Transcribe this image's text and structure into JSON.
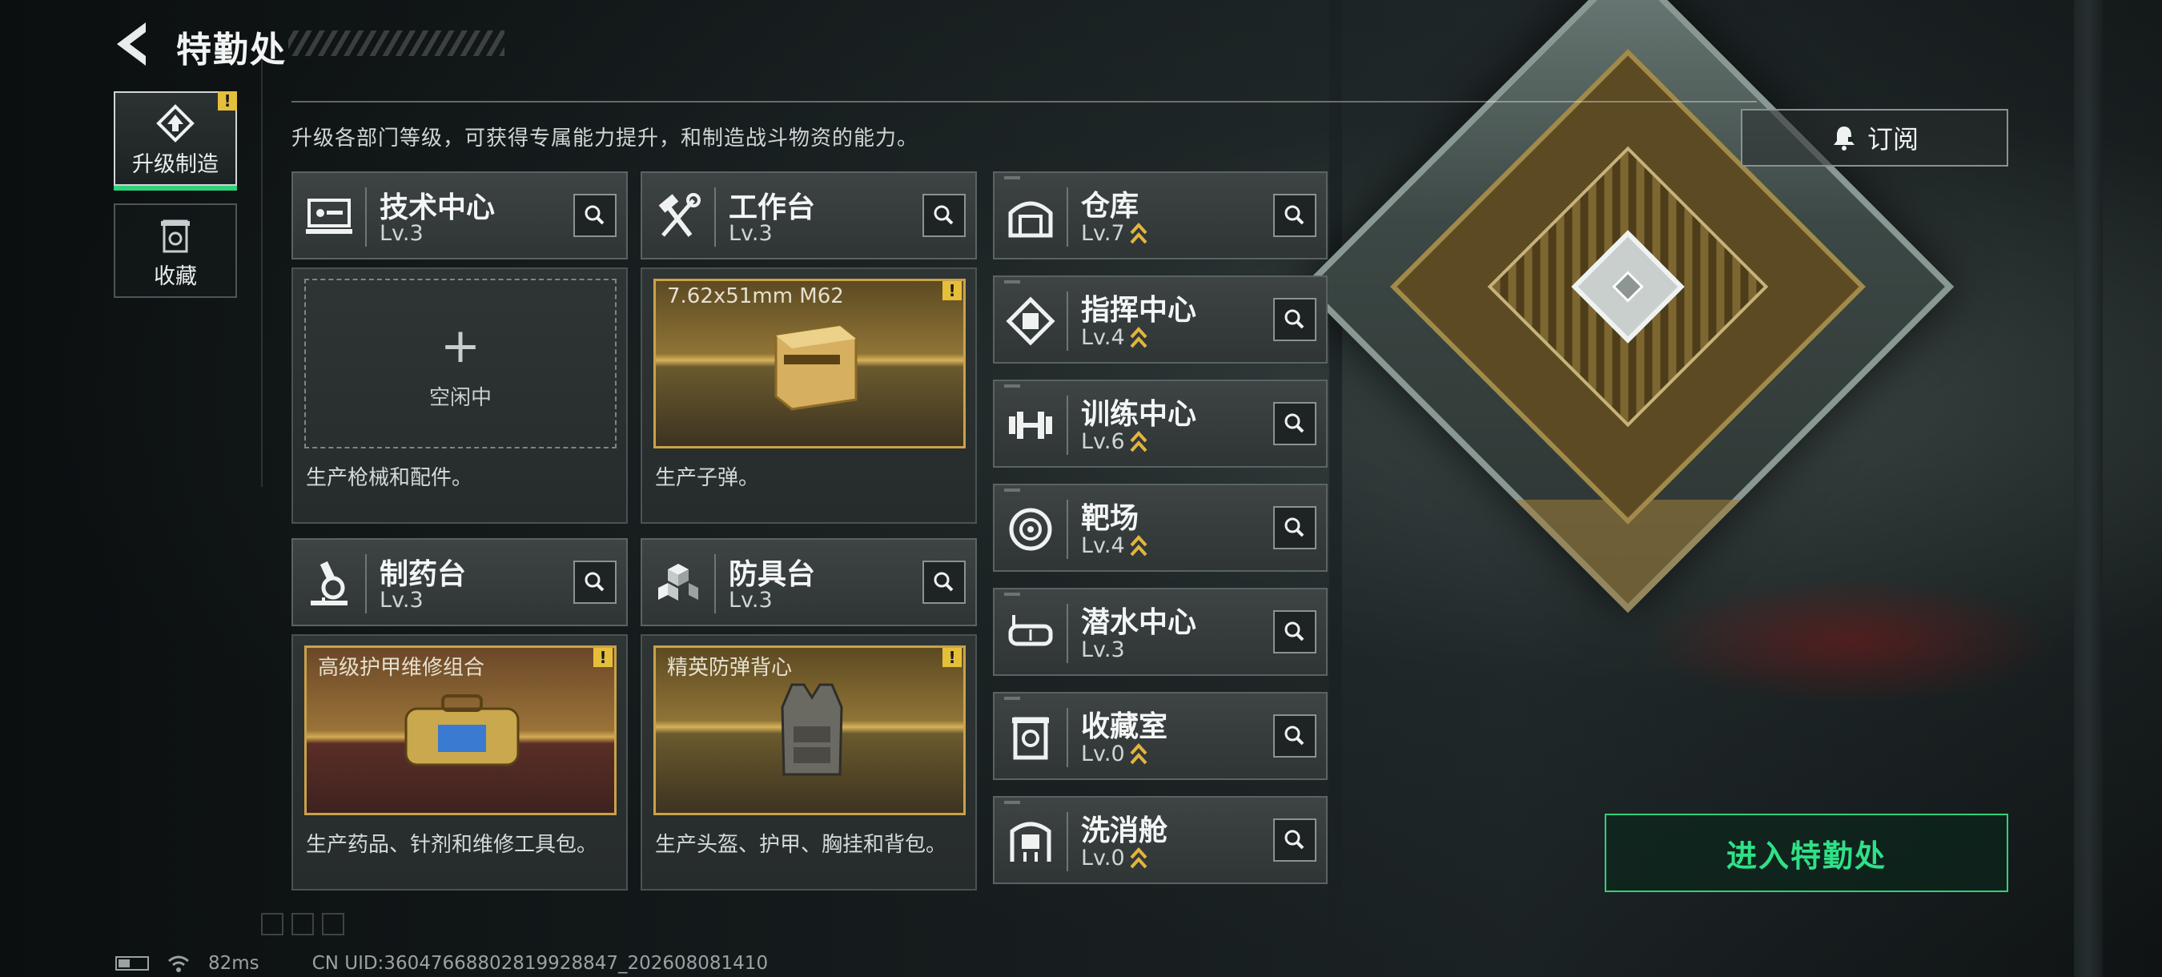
{
  "header": {
    "title": "特勤处"
  },
  "sidebar": {
    "tabs": [
      {
        "label": "升级制造",
        "active": true,
        "alert": "!"
      },
      {
        "label": "收藏",
        "active": false
      }
    ]
  },
  "description": "升级各部门等级，可获得专属能力提升，和制造战斗物资的能力。",
  "subscribe_label": "订阅",
  "stations": [
    {
      "name": "技术中心",
      "level": "Lv.3",
      "body": {
        "state": "idle",
        "plus": "+",
        "idle_label": "空闲中",
        "desc": "生产枪械和配件。"
      }
    },
    {
      "name": "工作台",
      "level": "Lv.3",
      "body": {
        "state": "producing",
        "item": "7.62x51mm M62",
        "alert": "!",
        "desc": "生产子弹。"
      }
    },
    {
      "name": "制药台",
      "level": "Lv.3",
      "body": {
        "state": "producing",
        "item": "高级护甲维修组合",
        "alert": "!",
        "desc": "生产药品、针剂和维修工具包。"
      }
    },
    {
      "name": "防具台",
      "level": "Lv.3",
      "body": {
        "state": "producing",
        "item": "精英防弹背心",
        "alert": "!",
        "desc": "生产头盔、护甲、胸挂和背包。"
      }
    }
  ],
  "departments": [
    {
      "name": "仓库",
      "level": "Lv.7",
      "upgradable": true,
      "icon": "warehouse-icon"
    },
    {
      "name": "指挥中心",
      "level": "Lv.4",
      "upgradable": true,
      "icon": "command-icon"
    },
    {
      "name": "训练中心",
      "level": "Lv.6",
      "upgradable": true,
      "icon": "dumbbell-icon"
    },
    {
      "name": "靶场",
      "level": "Lv.4",
      "upgradable": true,
      "icon": "target-icon"
    },
    {
      "name": "潜水中心",
      "level": "Lv.3",
      "upgradable": false,
      "icon": "diving-mask-icon"
    },
    {
      "name": "收藏室",
      "level": "Lv.0",
      "upgradable": true,
      "icon": "collection-icon"
    },
    {
      "name": "洗消舱",
      "level": "Lv.0",
      "upgradable": true,
      "icon": "decon-icon"
    }
  ],
  "enter_button": "进入特勤处",
  "status_bar": {
    "ping": "82ms",
    "uid": "CN UID:36047668802819928847_202608081410"
  },
  "colors": {
    "accent_green": "#2fd17b",
    "alert_yellow": "#e6bf3a",
    "gold_chevron": "#e3b53c"
  }
}
